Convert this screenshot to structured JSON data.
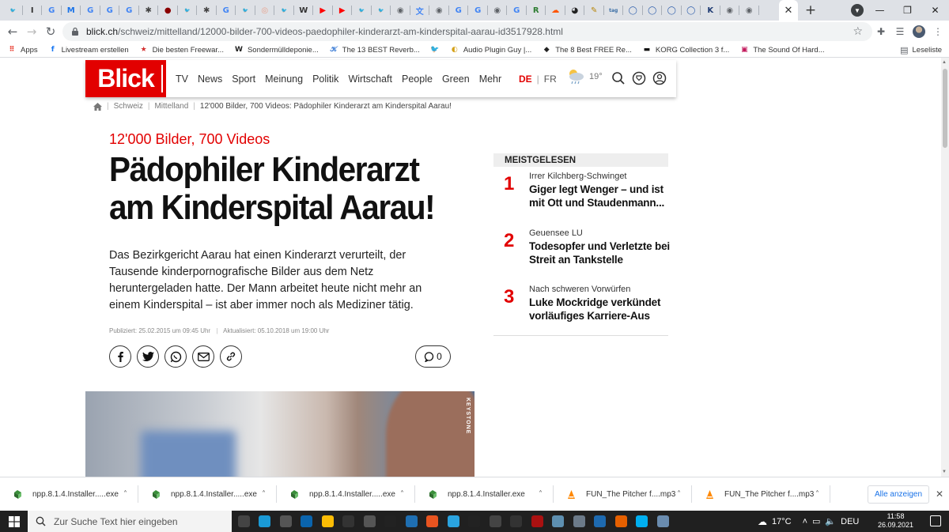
{
  "browser": {
    "tabs": [
      {
        "icon": "twitter-icon",
        "glyph": "🐦",
        "color": "#1da1f2"
      },
      {
        "icon": "extension-icon",
        "glyph": "I",
        "color": "#333"
      },
      {
        "icon": "google-icon",
        "glyph": "G",
        "color": "#4285f4"
      },
      {
        "icon": "m-icon",
        "glyph": "M",
        "color": "#1a73e8"
      },
      {
        "icon": "google-icon",
        "glyph": "G",
        "color": "#4285f4"
      },
      {
        "icon": "google-icon",
        "glyph": "G",
        "color": "#4285f4"
      },
      {
        "icon": "google-icon",
        "glyph": "G",
        "color": "#4285f4"
      },
      {
        "icon": "star-icon",
        "glyph": "✱",
        "color": "#444"
      },
      {
        "icon": "record-icon",
        "glyph": "●",
        "color": "#8b0000"
      },
      {
        "icon": "twitter-icon",
        "glyph": "🐦",
        "color": "#1da1f2"
      },
      {
        "icon": "star-icon",
        "glyph": "✱",
        "color": "#444"
      },
      {
        "icon": "google-icon",
        "glyph": "G",
        "color": "#4285f4"
      },
      {
        "icon": "twitter-icon",
        "glyph": "🐦",
        "color": "#1da1f2"
      },
      {
        "icon": "circle-icon",
        "glyph": "◎",
        "color": "#e8a08a"
      },
      {
        "icon": "twitter-icon",
        "glyph": "🐦",
        "color": "#1da1f2"
      },
      {
        "icon": "wikipedia-icon",
        "glyph": "W",
        "color": "#333"
      },
      {
        "icon": "youtube-icon",
        "glyph": "▶",
        "color": "#ff0000"
      },
      {
        "icon": "youtube-icon",
        "glyph": "▶",
        "color": "#ff0000"
      },
      {
        "icon": "twitter-icon",
        "glyph": "🐦",
        "color": "#1da1f2"
      },
      {
        "icon": "twitter-icon",
        "glyph": "🐦",
        "color": "#1da1f2"
      },
      {
        "icon": "globe-icon",
        "glyph": "◉",
        "color": "#5f6368"
      },
      {
        "icon": "translate-icon",
        "glyph": "文",
        "color": "#4285f4"
      },
      {
        "icon": "globe-icon",
        "glyph": "◉",
        "color": "#5f6368"
      },
      {
        "icon": "google-icon",
        "glyph": "G",
        "color": "#4285f4"
      },
      {
        "icon": "google-icon",
        "glyph": "G",
        "color": "#4285f4"
      },
      {
        "icon": "globe-icon",
        "glyph": "◉",
        "color": "#5f6368"
      },
      {
        "icon": "google-icon",
        "glyph": "G",
        "color": "#4285f4"
      },
      {
        "icon": "rx-icon",
        "glyph": "R",
        "color": "#2e7d32"
      },
      {
        "icon": "soundcloud-icon",
        "glyph": "☁",
        "color": "#ff5500"
      },
      {
        "icon": "github-icon",
        "glyph": "◕",
        "color": "#222"
      },
      {
        "icon": "notes-icon",
        "glyph": "✎",
        "color": "#b8860b"
      },
      {
        "icon": "tag-icon",
        "glyph": "tag",
        "color": "#3a6ea5"
      },
      {
        "icon": "shield-icon",
        "glyph": "◯",
        "color": "#2b5cab"
      },
      {
        "icon": "shield-icon",
        "glyph": "◯",
        "color": "#2b5cab"
      },
      {
        "icon": "shield-icon",
        "glyph": "◯",
        "color": "#2b5cab"
      },
      {
        "icon": "shield-icon",
        "glyph": "◯",
        "color": "#2b5cab"
      },
      {
        "icon": "k-icon",
        "glyph": "K",
        "color": "#1f3b73"
      },
      {
        "icon": "globe-icon",
        "glyph": "◉",
        "color": "#5f6368"
      },
      {
        "icon": "chrome-icon",
        "glyph": "◉",
        "color": "#5f6368"
      }
    ],
    "url_host": "blick.ch",
    "url_path": "/schweiz/mittelland/12000-bilder-700-videos-paedophiler-kinderarzt-am-kinderspital-aarau-id3517928.html"
  },
  "bookmarks": {
    "items": [
      {
        "label": "Apps",
        "icon": "apps-icon",
        "glyph": "⠿",
        "color": "#e94235"
      },
      {
        "label": "Livestream erstellen",
        "icon": "facebook-icon",
        "glyph": "f",
        "color": "#1877f2"
      },
      {
        "label": "Die besten Freewar...",
        "icon": "star-icon",
        "glyph": "★",
        "color": "#d32f2f"
      },
      {
        "label": "Sondermülldeponie...",
        "icon": "wikipedia-icon",
        "glyph": "W",
        "color": "#222"
      },
      {
        "label": "The 13 BEST Reverb...",
        "icon": "reverb-icon",
        "glyph": "𝒦",
        "color": "#3a7bd5"
      },
      {
        "label": "",
        "icon": "twitter-icon",
        "glyph": "🐦",
        "color": "#1da1f2"
      },
      {
        "label": "Audio Plugin Guy |...",
        "icon": "plugin-icon",
        "glyph": "◐",
        "color": "#d4a017"
      },
      {
        "label": "The 8 Best FREE Re...",
        "icon": "bookmark-icon",
        "glyph": "◆",
        "color": "#222"
      },
      {
        "label": "KORG Collection 3 f...",
        "icon": "korg-icon",
        "glyph": "▬",
        "color": "#111"
      },
      {
        "label": "The Sound Of Hard...",
        "icon": "image-icon",
        "glyph": "▣",
        "color": "#c2185b"
      }
    ],
    "reading_list": "Leseliste"
  },
  "site": {
    "logo": "Blick",
    "nav": [
      "TV",
      "News",
      "Sport",
      "Meinung",
      "Politik",
      "Wirtschaft",
      "People",
      "Green",
      "Mehr"
    ],
    "lang_de": "DE",
    "lang_fr": "FR",
    "temperature": "19°"
  },
  "breadcrumb": {
    "items": [
      "Schweiz",
      "Mittelland"
    ],
    "current": "12'000 Bilder, 700 Videos: Pädophiler Kinderarzt am Kinderspital Aarau!"
  },
  "article": {
    "kicker": "12'000 Bilder, 700 Videos",
    "title": "Pädophiler Kinderarzt am Kinderspital Aarau!",
    "lead": "Das Bezirkgericht Aarau hat einen Kinderarzt verurteilt, der Tausende kinderpornografische Bilder aus dem Netz heruntergeladen hatte. Der Mann arbeitet heute nicht mehr an einem Kinderspital – ist aber immer noch als Mediziner tätig.",
    "published": "Publiziert: 25.02.2015 um 09:45 Uhr",
    "updated": "Aktualisiert: 05.10.2018 um 19:00 Uhr",
    "comments": "0",
    "image_credit": "KEYSTONE"
  },
  "meistgelesen": {
    "title": "MEISTGELESEN",
    "items": [
      {
        "num": "1",
        "kicker": "Irrer Kilchberg-Schwinget",
        "headline": "Giger legt Wenger – und ist mit Ott und Staudenmann..."
      },
      {
        "num": "2",
        "kicker": "Geuensee LU",
        "headline": "Todesopfer und Verletzte bei Streit an Tankstelle"
      },
      {
        "num": "3",
        "kicker": "Nach schweren Vorwürfen",
        "headline": "Luke Mockridge verkündet vorläufiges Karriere-Aus"
      }
    ]
  },
  "downloads": {
    "items": [
      {
        "name": "npp.8.1.4.Installer.....exe",
        "type": "exe"
      },
      {
        "name": "npp.8.1.4.Installer.....exe",
        "type": "exe"
      },
      {
        "name": "npp.8.1.4.Installer.....exe",
        "type": "exe"
      },
      {
        "name": "npp.8.1.4.Installer.exe",
        "type": "exe"
      },
      {
        "name": "FUN_The Pitcher f....mp3",
        "type": "mp3"
      },
      {
        "name": "FUN_The Pitcher f....mp3",
        "type": "mp3"
      }
    ],
    "show_all": "Alle anzeigen"
  },
  "taskbar": {
    "search_placeholder": "Zur Suche Text hier eingeben",
    "apps": [
      {
        "icon": "task-view-icon",
        "color": "#444"
      },
      {
        "icon": "edge-icon",
        "color": "#1a9ad6"
      },
      {
        "icon": "store-icon",
        "color": "#555"
      },
      {
        "icon": "mail-icon",
        "color": "#0a64ad"
      },
      {
        "icon": "chrome-icon",
        "color": "#fbbc05"
      },
      {
        "icon": "app-icon",
        "color": "#333"
      },
      {
        "icon": "app-icon",
        "color": "#555"
      },
      {
        "icon": "live-icon",
        "color": "#222"
      },
      {
        "icon": "app-icon",
        "color": "#1f6fb2"
      },
      {
        "icon": "ubuntu-icon",
        "color": "#e95420"
      },
      {
        "icon": "telegram-icon",
        "color": "#2aa3df"
      },
      {
        "icon": "app-icon",
        "color": "#222"
      },
      {
        "icon": "app-icon",
        "color": "#444"
      },
      {
        "icon": "app-icon",
        "color": "#333"
      },
      {
        "icon": "voicemeeter-icon",
        "color": "#a11"
      },
      {
        "icon": "app-icon",
        "color": "#5e8fb0"
      },
      {
        "icon": "virtualbox-icon",
        "color": "#6c7a89"
      },
      {
        "icon": "app-icon",
        "color": "#1e6ab0"
      },
      {
        "icon": "firefox-icon",
        "color": "#e66000"
      },
      {
        "icon": "skype-icon",
        "color": "#00aff0"
      },
      {
        "icon": "app-icon",
        "color": "#6a8caf"
      }
    ],
    "temperature": "17°C",
    "language": "DEU",
    "time": "11:58",
    "date": "26.09.2021"
  }
}
